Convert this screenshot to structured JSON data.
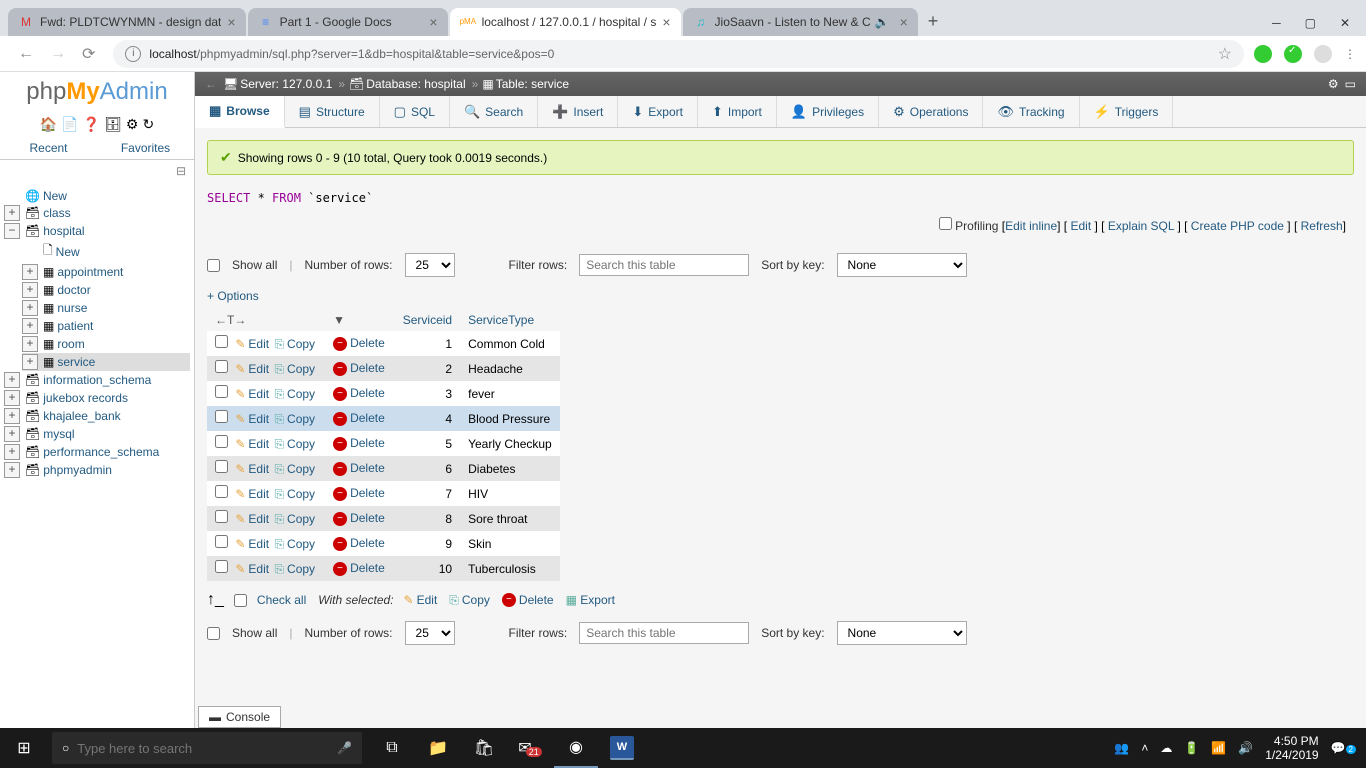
{
  "browser": {
    "tabs": [
      {
        "icon": "M",
        "title": "Fwd: PLDTCWYNMN - design dat"
      },
      {
        "icon": "≡",
        "title": "Part 1 - Google Docs"
      },
      {
        "icon": "pMA",
        "title": "localhost / 127.0.0.1 / hospital / s",
        "active": true
      },
      {
        "icon": "🎵",
        "title": "JioSaavn - Listen to New & C",
        "sound": true
      }
    ],
    "url": "localhost/phpmyadmin/sql.php?server=1&db=hospital&table=service&pos=0"
  },
  "pma_logo": {
    "p1": "php",
    "p2": "My",
    "p3": "Admin"
  },
  "sidebar_tabs": {
    "recent": "Recent",
    "favorites": "Favorites"
  },
  "tree": {
    "new": "New",
    "dbs": [
      {
        "name": "class",
        "expanded": false
      },
      {
        "name": "hospital",
        "expanded": true,
        "children": [
          {
            "name": "New",
            "type": "new"
          },
          {
            "name": "appointment"
          },
          {
            "name": "doctor"
          },
          {
            "name": "nurse"
          },
          {
            "name": "patient"
          },
          {
            "name": "room"
          },
          {
            "name": "service",
            "selected": true
          }
        ]
      },
      {
        "name": "information_schema"
      },
      {
        "name": "jukebox records"
      },
      {
        "name": "khajalee_bank"
      },
      {
        "name": "mysql"
      },
      {
        "name": "performance_schema"
      },
      {
        "name": "phpmyadmin"
      }
    ]
  },
  "breadcrumb": {
    "server_label": "Server:",
    "server": "127.0.0.1",
    "db_label": "Database:",
    "db": "hospital",
    "table_label": "Table:",
    "table": "service"
  },
  "main_tabs": [
    "Browse",
    "Structure",
    "SQL",
    "Search",
    "Insert",
    "Export",
    "Import",
    "Privileges",
    "Operations",
    "Tracking",
    "Triggers"
  ],
  "tab_icons": [
    "▦",
    "▤",
    "▢",
    "🔍",
    "➕",
    "⬇",
    "⬆",
    "👤",
    "⚙",
    "👁",
    "⚡"
  ],
  "success": "Showing rows 0 - 9 (10 total, Query took 0.0019 seconds.)",
  "sql": {
    "select": "SELECT",
    "star": " * ",
    "from": "FROM",
    "table": " `service`"
  },
  "links": {
    "profiling": "Profiling",
    "edit_inline": "Edit inline",
    "edit": "Edit",
    "explain": "Explain SQL",
    "php": "Create PHP code",
    "refresh": "Refresh"
  },
  "controls": {
    "show_all": "Show all",
    "num_rows": "Number of rows:",
    "rows_value": "25",
    "filter_label": "Filter rows:",
    "filter_placeholder": "Search this table",
    "sort_label": "Sort by key:",
    "sort_value": "None"
  },
  "options_label": "+ Options",
  "columns": {
    "arrows": "←T→",
    "drop": "▼",
    "c1": "Serviceid",
    "c2": "ServiceType"
  },
  "actions": {
    "edit": "Edit",
    "copy": "Copy",
    "delete": "Delete"
  },
  "rows": [
    {
      "id": 1,
      "type": "Common Cold"
    },
    {
      "id": 2,
      "type": "Headache"
    },
    {
      "id": 3,
      "type": "fever"
    },
    {
      "id": 4,
      "type": "Blood Pressure",
      "hl": true
    },
    {
      "id": 5,
      "type": "Yearly Checkup"
    },
    {
      "id": 6,
      "type": "Diabetes"
    },
    {
      "id": 7,
      "type": "HIV"
    },
    {
      "id": 8,
      "type": "Sore throat"
    },
    {
      "id": 9,
      "type": "Skin"
    },
    {
      "id": 10,
      "type": "Tuberculosis"
    }
  ],
  "bulk": {
    "check_all": "Check all",
    "with_selected": "With selected:",
    "edit": "Edit",
    "copy": "Copy",
    "delete": "Delete",
    "export": "Export"
  },
  "console": "Console",
  "taskbar": {
    "search_placeholder": "Type here to search",
    "time": "4:50 PM",
    "date": "1/24/2019"
  }
}
